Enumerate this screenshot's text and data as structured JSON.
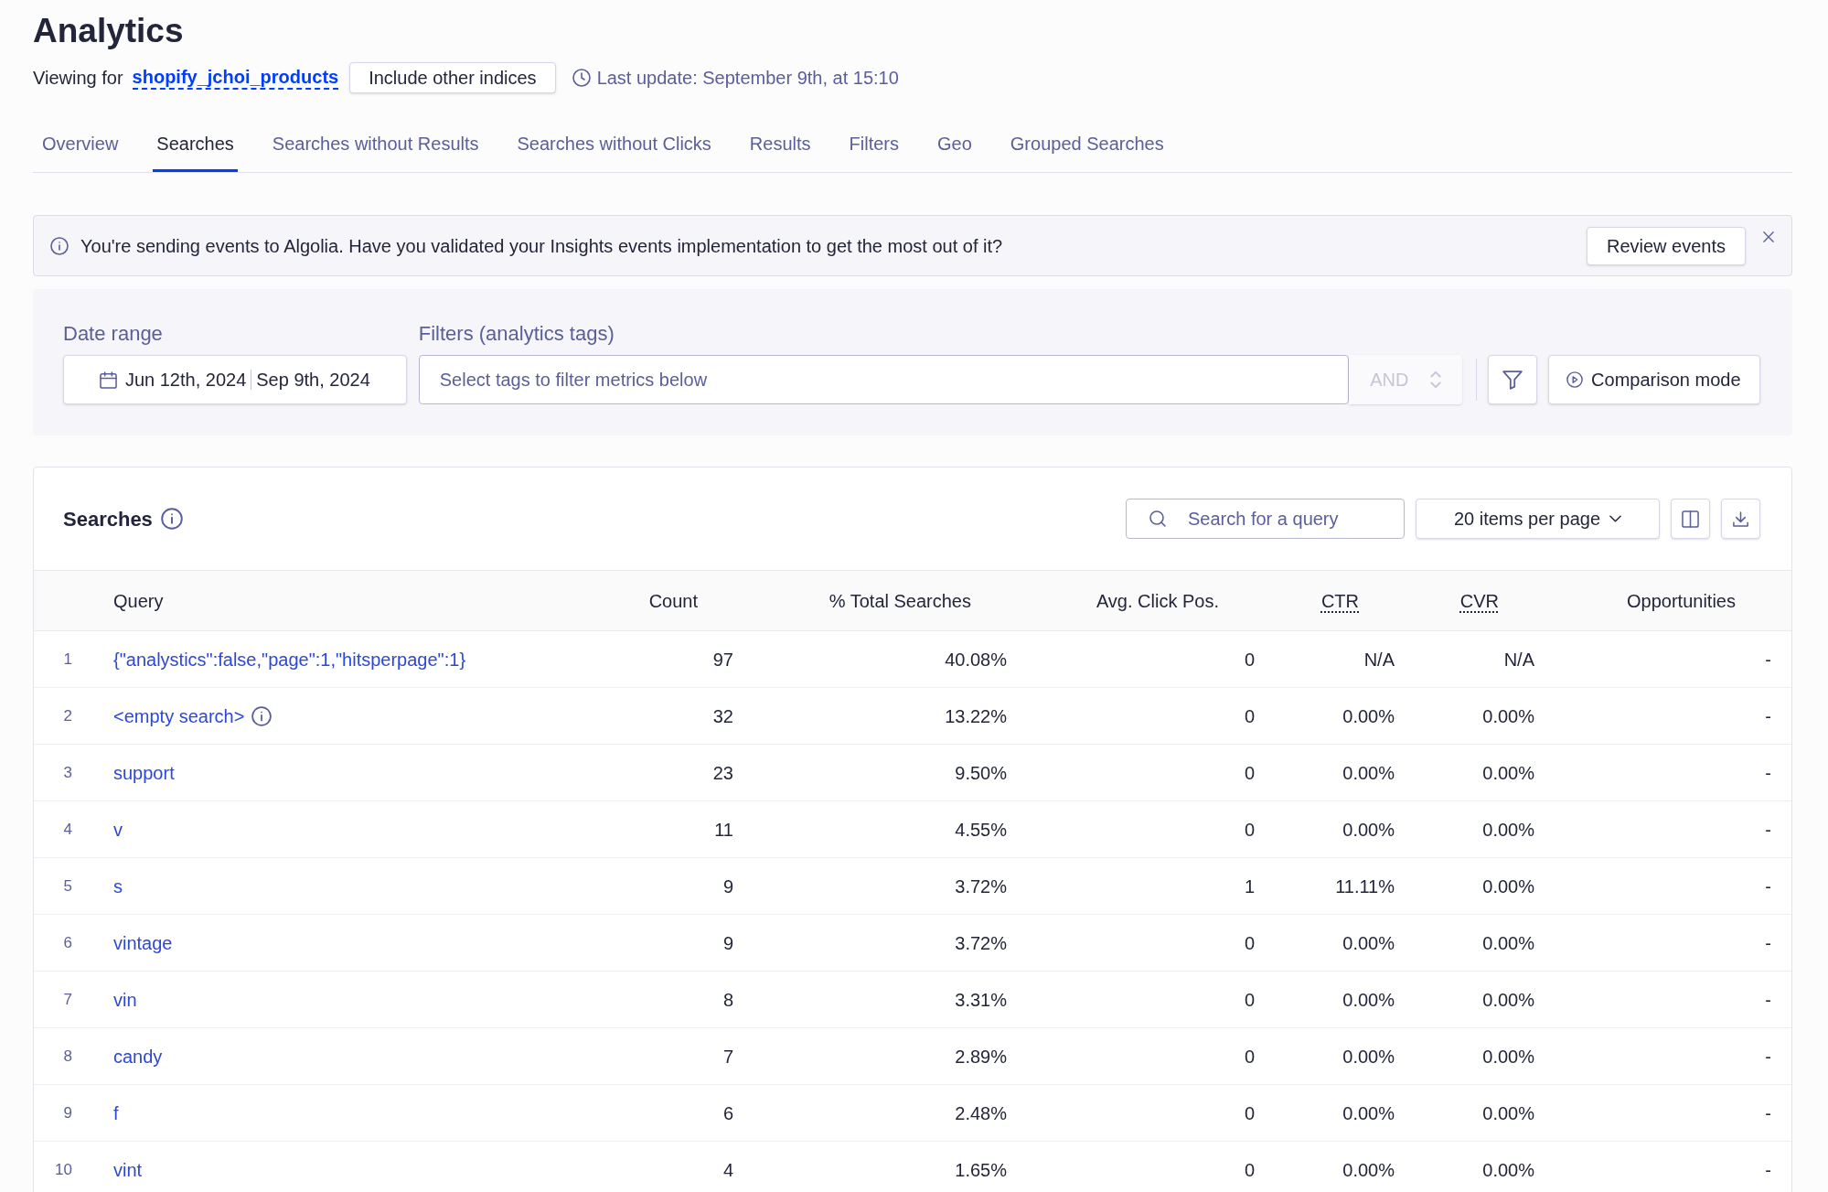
{
  "page": {
    "title": "Analytics"
  },
  "index_bar": {
    "label": "Viewing for",
    "index_name": "shopify_jchoi_products",
    "include_button": "Include other indices",
    "last_update": "Last update: September 9th, at 15:10"
  },
  "tabs": [
    {
      "label": "Overview",
      "selected": false
    },
    {
      "label": "Searches",
      "selected": true
    },
    {
      "label": "Searches without Results",
      "selected": false
    },
    {
      "label": "Searches without Clicks",
      "selected": false
    },
    {
      "label": "Results",
      "selected": false
    },
    {
      "label": "Filters",
      "selected": false
    },
    {
      "label": "Geo",
      "selected": false
    },
    {
      "label": "Grouped Searches",
      "selected": false
    }
  ],
  "banner": {
    "message": "You're sending events to Algolia. Have you validated your Insights events implementation to get the most out of it?",
    "button": "Review events"
  },
  "filter_panel": {
    "date_range": {
      "label": "Date range",
      "start": "Jun 12th, 2024",
      "end": "Sep 9th, 2024"
    },
    "tags": {
      "label": "Filters (analytics tags)",
      "placeholder": "Select tags to filter metrics below"
    },
    "operator": {
      "value": "AND",
      "disabled": true
    },
    "comparison_button": "Comparison mode"
  },
  "searches": {
    "title": "Searches",
    "search": {
      "placeholder": "Search for a query"
    },
    "page_size": "20 items per page",
    "columns": [
      {
        "label": "Query",
        "tooltip": false
      },
      {
        "label": "Count",
        "tooltip": false
      },
      {
        "label": "% Total Searches",
        "tooltip": false
      },
      {
        "label": "Avg. Click Pos.",
        "tooltip": false
      },
      {
        "label": "CTR",
        "tooltip": true
      },
      {
        "label": "CVR",
        "tooltip": true
      },
      {
        "label": "Opportunities",
        "tooltip": false
      }
    ],
    "rows": [
      {
        "rank": "1",
        "query": "{\"analystics\":false,\"page\":1,\"hitsperpage\":1}",
        "info": false,
        "values": [
          "97",
          "40.08%",
          "0",
          "N/A",
          "N/A",
          "-"
        ]
      },
      {
        "rank": "2",
        "query": "<empty search>",
        "info": true,
        "values": [
          "32",
          "13.22%",
          "0",
          "0.00%",
          "0.00%",
          "-"
        ]
      },
      {
        "rank": "3",
        "query": "support",
        "info": false,
        "values": [
          "23",
          "9.50%",
          "0",
          "0.00%",
          "0.00%",
          "-"
        ]
      },
      {
        "rank": "4",
        "query": "v",
        "info": false,
        "values": [
          "11",
          "4.55%",
          "0",
          "0.00%",
          "0.00%",
          "-"
        ]
      },
      {
        "rank": "5",
        "query": "s",
        "info": false,
        "values": [
          "9",
          "3.72%",
          "1",
          "11.11%",
          "0.00%",
          "-"
        ]
      },
      {
        "rank": "6",
        "query": "vintage",
        "info": false,
        "values": [
          "9",
          "3.72%",
          "0",
          "0.00%",
          "0.00%",
          "-"
        ]
      },
      {
        "rank": "7",
        "query": "vin",
        "info": false,
        "values": [
          "8",
          "3.31%",
          "0",
          "0.00%",
          "0.00%",
          "-"
        ]
      },
      {
        "rank": "8",
        "query": "candy",
        "info": false,
        "values": [
          "7",
          "2.89%",
          "0",
          "0.00%",
          "0.00%",
          "-"
        ]
      },
      {
        "rank": "9",
        "query": "f",
        "info": false,
        "values": [
          "6",
          "2.48%",
          "0",
          "0.00%",
          "0.00%",
          "-"
        ]
      },
      {
        "rank": "10",
        "query": "vint",
        "info": false,
        "values": [
          "4",
          "1.65%",
          "0",
          "0.00%",
          "0.00%",
          "-"
        ]
      }
    ]
  }
}
